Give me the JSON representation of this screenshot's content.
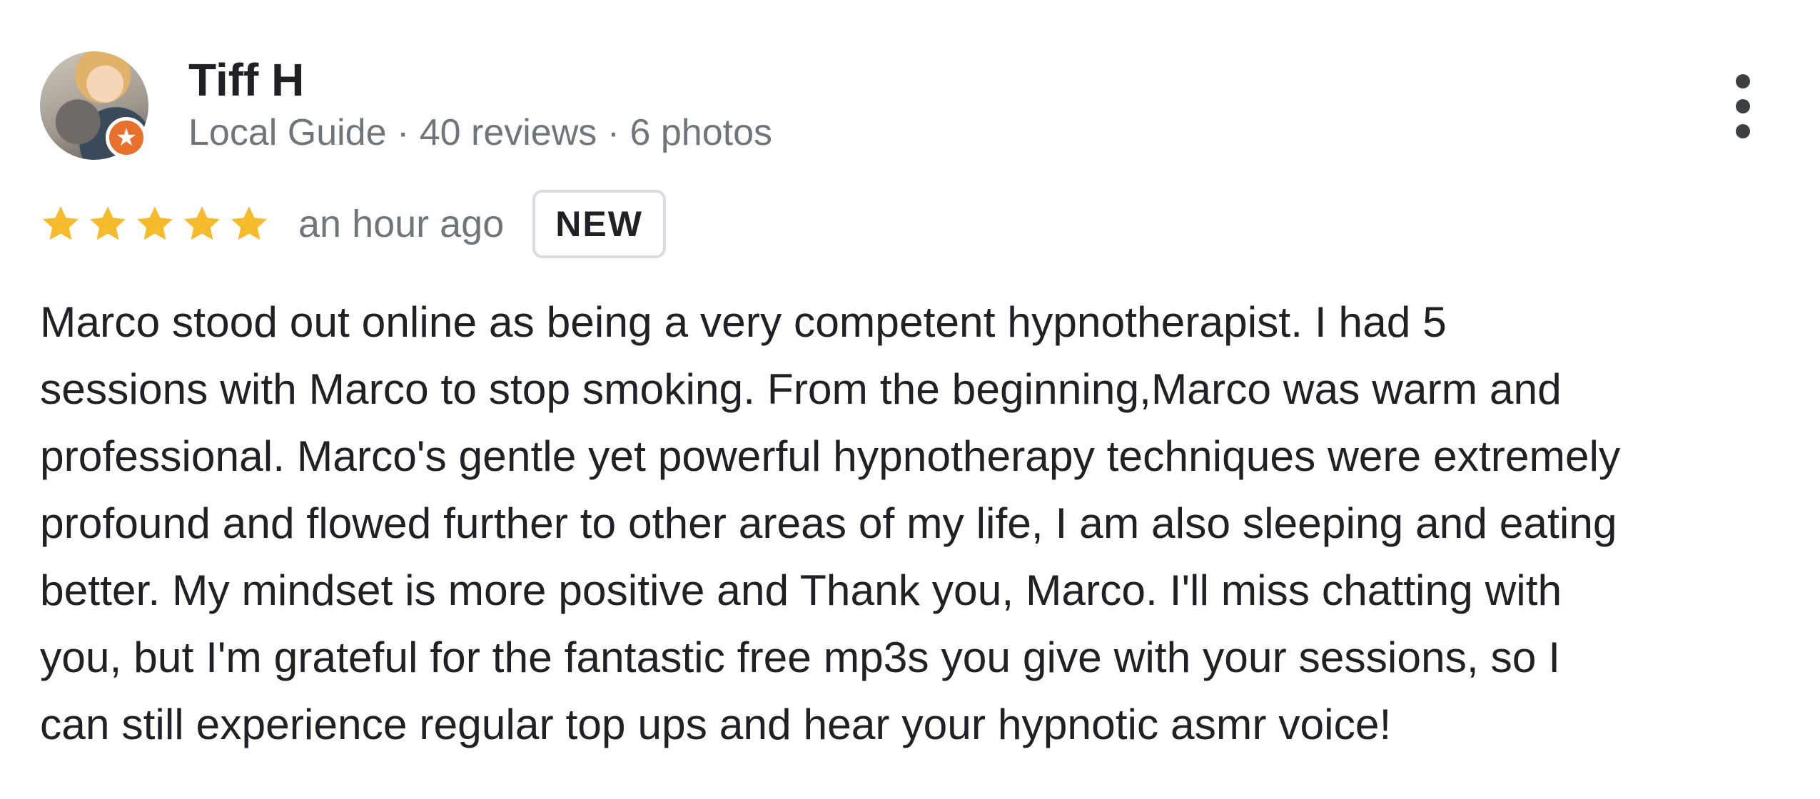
{
  "review": {
    "author": {
      "name": "Tiff H",
      "meta": "Local Guide · 40 reviews · 6 photos",
      "badge_icon": "star-icon"
    },
    "rating": {
      "stars": 5,
      "max_stars": 5,
      "color": "#f6bb2b"
    },
    "time_ago": "an hour ago",
    "badge_label": "NEW",
    "text_lines": [
      "Marco stood out online as being a very competent hypnotherapist. I had 5",
      "sessions with Marco to stop smoking. From the beginning,Marco was warm and",
      "professional. Marco's gentle yet powerful hypnotherapy techniques were extremely",
      "profound and flowed further to other areas of my life, I am also sleeping and eating",
      "better. My mindset is more positive and Thank you, Marco. I'll miss chatting with",
      "you, but I'm grateful for the fantastic free mp3s you give with your sessions, so I",
      "can still experience regular top ups and hear your hypnotic asmr voice!"
    ],
    "more_options_icon": "more-vert-icon"
  },
  "colors": {
    "primary_text": "#202124",
    "secondary_text": "#70757a",
    "badge_border": "#dadce0",
    "guide_badge": "#e8702a"
  }
}
